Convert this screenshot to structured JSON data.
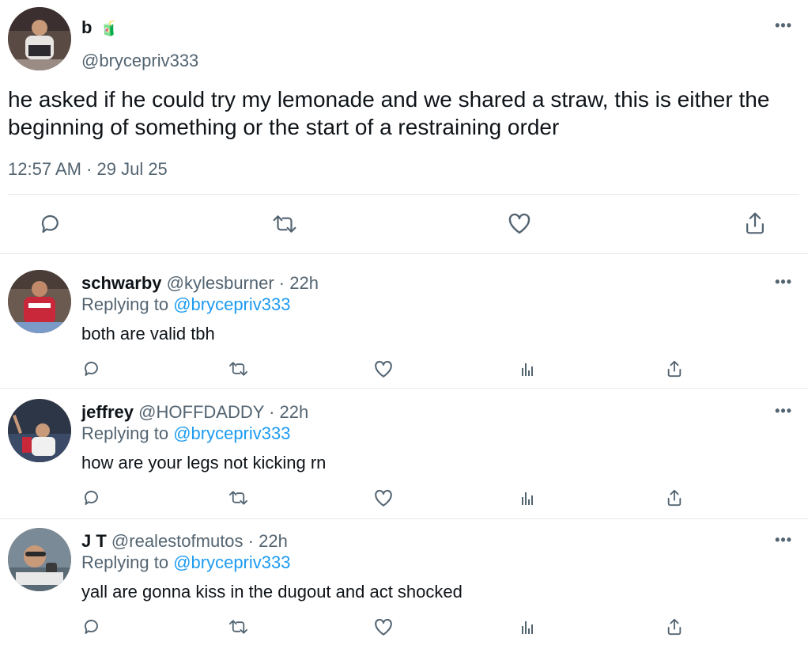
{
  "main_tweet": {
    "display_name": "b",
    "name_emoji": "🧃",
    "handle": "@brycepriv333",
    "text": "he asked if he could try my lemonade and we shared a straw, this is either the beginning of something or the start of a restraining order",
    "timestamp": "12:57 AM · 29 Jul 25",
    "more": "•••"
  },
  "replies": [
    {
      "name": "schwarby",
      "handle": "@kylesburner",
      "time": " · 22h",
      "replying_label": "Replying to ",
      "replying_to": "@brycepriv333",
      "text": "both are valid tbh",
      "more": "•••"
    },
    {
      "name": "jeffrey",
      "handle": "@HOFFDADDY",
      "time": " · 22h",
      "replying_label": "Replying to ",
      "replying_to": "@brycepriv333",
      "text": "how are your legs not kicking rn",
      "more": "•••"
    },
    {
      "name": "J T",
      "handle": "@realestofmutos",
      "time": " · 22h",
      "replying_label": "Replying to ",
      "replying_to": "@brycepriv333",
      "text": "yall are gonna kiss in the dugout and act shocked",
      "more": "•••"
    }
  ],
  "colors": {
    "text": "#0f1419",
    "secondary": "#536471",
    "link": "#1d9bf0",
    "divider": "#e6e9eb"
  },
  "icons": {
    "main_actions": [
      "reply-icon",
      "retweet-icon",
      "like-icon",
      "share-icon"
    ],
    "reply_actions": [
      "reply-icon",
      "retweet-icon",
      "like-icon",
      "views-icon",
      "share-icon"
    ]
  }
}
